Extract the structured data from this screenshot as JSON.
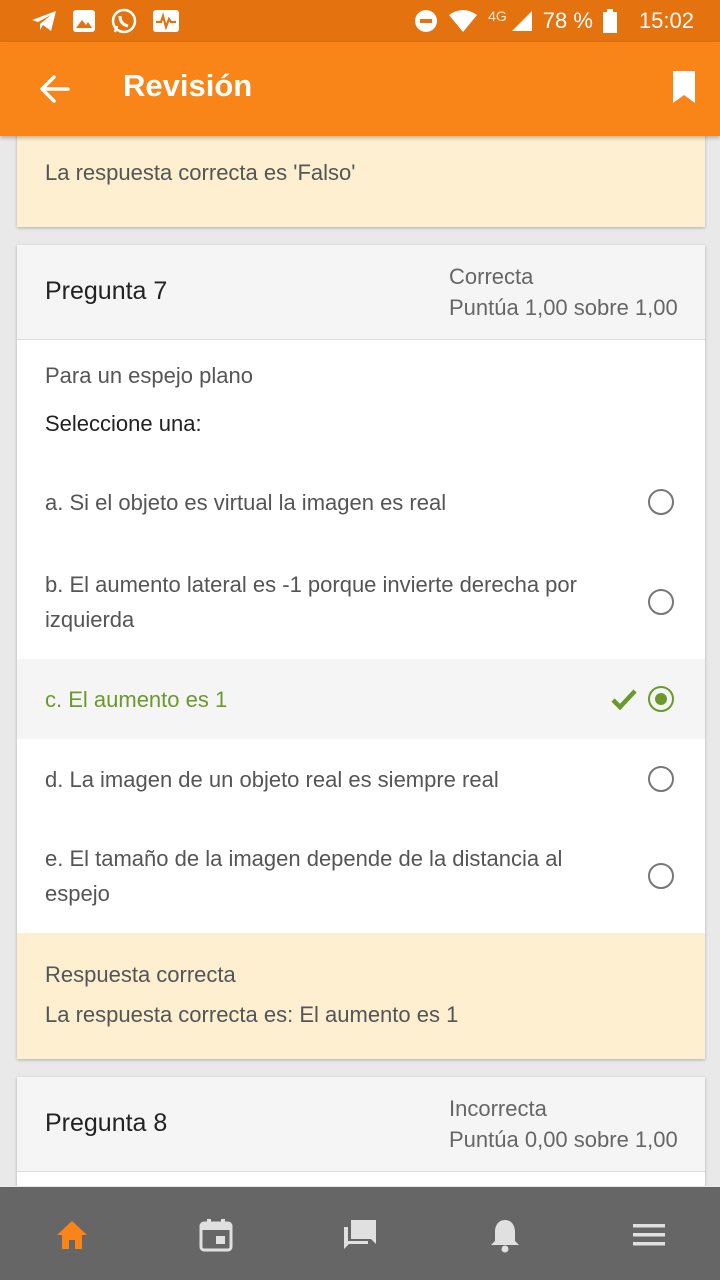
{
  "status_bar": {
    "network": "4G",
    "battery": "78 %",
    "time": "15:02"
  },
  "app_bar": {
    "title": "Revisión"
  },
  "prev_feedback": {
    "text": "La respuesta correcta es 'Falso'"
  },
  "question7": {
    "number_label": "Pregunta 7",
    "state": "Correcta",
    "grade": "Puntúa 1,00 sobre 1,00",
    "text": "Para un espejo plano",
    "prompt": "Seleccione una:",
    "options": [
      {
        "label": "a. Si el objeto es virtual la imagen es real",
        "selected": false
      },
      {
        "label": "b. El aumento lateral es -1 porque invierte derecha por izquierda",
        "selected": false
      },
      {
        "label": "c. El aumento es 1",
        "selected": true,
        "correct": true
      },
      {
        "label": "d. La imagen de un objeto real es siempre real",
        "selected": false
      },
      {
        "label": "e. El tamaño de la imagen depende de la distancia al espejo",
        "selected": false
      }
    ],
    "feedback_title": "Respuesta correcta",
    "feedback_text": "La respuesta correcta es: El aumento es 1"
  },
  "question8": {
    "number_label": "Pregunta 8",
    "state": "Incorrecta",
    "grade": "Puntúa 0,00 sobre 1,00"
  },
  "bottom_nav": {
    "items": [
      "home-icon",
      "calendar-icon",
      "messages-icon",
      "notifications-icon",
      "menu-icon"
    ],
    "active_color": "#f98518",
    "inactive_color": "#e0e0e0"
  },
  "colors": {
    "primary": "#f98518",
    "status_bar": "#e3720f",
    "correct": "#6a9a2c",
    "feedback_bg": "#fdefd0"
  }
}
